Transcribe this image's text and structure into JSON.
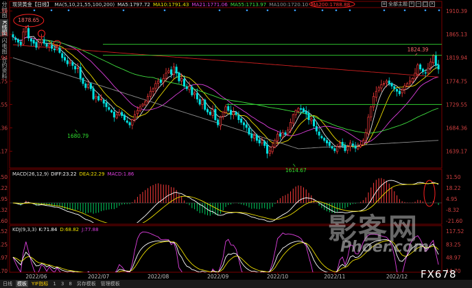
{
  "header": {
    "instrument": "现货黄金",
    "period_tag": "【日线】",
    "ma_items": [
      {
        "text": "MA(5,10,21,55,100,200)",
        "color": "#d0d0d0"
      },
      {
        "text": "MA5:1797.72",
        "color": "#e0e0e0"
      },
      {
        "text": "MA10:1791.43",
        "color": "#f0e000"
      },
      {
        "text": "MA21:1771.06",
        "color": "#e040e0"
      },
      {
        "text": "MA55:1713.97",
        "color": "#40e040"
      },
      {
        "text": "MA100:1720.10",
        "color": "#909090"
      },
      {
        "text": "MA200:1788.88",
        "color": "#ff3030"
      }
    ],
    "right_label": "全部主题"
  },
  "left_tabs": [
    {
      "label": "分时图",
      "active": false
    },
    {
      "label": "K线图",
      "active": true
    },
    {
      "label": "闪电图",
      "active": false
    },
    {
      "label": "合约资料",
      "active": false
    }
  ],
  "macd": {
    "title": "MACD(26,12,9)",
    "diff": "DIFF:23.22",
    "dea": "DEA:22.29",
    "macd": "MACD:1.86"
  },
  "kdj": {
    "title": "KDJ(9,3,3)",
    "k": "K:71.84",
    "d": "D:68.82",
    "j": "J:77.88"
  },
  "bottom_bar": [
    "日线",
    "模板",
    "YIF指标",
    "1",
    "3",
    "8",
    "另存模板",
    "管理模板"
  ],
  "left_bottom_tabs": [
    "指标"
  ],
  "watermark": {
    "line1": "影客网",
    "line2": "Phoer.com"
  },
  "fx_label": "FX678",
  "chart_data": [
    {
      "type": "candlestick",
      "title": "现货黄金【日线】",
      "y_ticks": [
        1910.39,
        1865.13,
        1819.94,
        1774.75,
        1729.55,
        1684.36,
        1639.17
      ],
      "ylim": [
        1614.67,
        1910.39
      ],
      "x_ticks": [
        "2022/06",
        "2022/07",
        "2022/08",
        "2022/09",
        "2022/10",
        "2022/11",
        "2022/12"
      ],
      "annotations": [
        {
          "label": "1878.65",
          "value": 1878.65
        },
        {
          "label": "1680.79",
          "value": 1680.79
        },
        {
          "label": "1614.67",
          "value": 1614.67
        },
        {
          "label": "1824.39",
          "value": 1824.39
        }
      ],
      "horizontal_lines": [
        1846,
        1825,
        1729.55
      ],
      "series": [
        {
          "name": "MA5",
          "last": 1797.72
        },
        {
          "name": "MA10",
          "last": 1791.43
        },
        {
          "name": "MA21",
          "last": 1771.06
        },
        {
          "name": "MA55",
          "last": 1713.97
        },
        {
          "name": "MA100",
          "last": 1720.1
        },
        {
          "name": "MA200",
          "last": 1788.88
        }
      ],
      "closes": [
        1860,
        1855,
        1850,
        1845,
        1870,
        1878,
        1858,
        1852,
        1848,
        1840,
        1850,
        1856,
        1848,
        1842,
        1845,
        1838,
        1835,
        1840,
        1830,
        1820,
        1815,
        1808,
        1812,
        1805,
        1798,
        1800,
        1780,
        1770,
        1762,
        1768,
        1760,
        1740,
        1745,
        1738,
        1740,
        1732,
        1725,
        1720,
        1715,
        1705,
        1710,
        1715,
        1708,
        1700,
        1695,
        1690,
        1700,
        1710,
        1718,
        1725,
        1730,
        1735,
        1745,
        1755,
        1760,
        1770,
        1775,
        1772,
        1780,
        1790,
        1795,
        1788,
        1802,
        1790,
        1775,
        1780,
        1765,
        1760,
        1765,
        1748,
        1752,
        1740,
        1730,
        1738,
        1720,
        1715,
        1710,
        1720,
        1700,
        1690,
        1705,
        1715,
        1725,
        1718,
        1710,
        1715,
        1710,
        1700,
        1695,
        1690,
        1685,
        1672,
        1665,
        1670,
        1660,
        1655,
        1660,
        1650,
        1635,
        1640,
        1648,
        1660,
        1672,
        1668,
        1675,
        1672,
        1680,
        1695,
        1710,
        1718,
        1722,
        1720,
        1715,
        1712,
        1700,
        1702,
        1688,
        1678,
        1670,
        1665,
        1660,
        1655,
        1650,
        1645,
        1640,
        1648,
        1655,
        1650,
        1640,
        1648,
        1655,
        1650,
        1645,
        1648,
        1652,
        1660,
        1675,
        1705,
        1725,
        1745,
        1755,
        1762,
        1768,
        1770,
        1775,
        1770,
        1765,
        1760,
        1755,
        1750,
        1758,
        1766,
        1770,
        1775,
        1780,
        1790,
        1806,
        1798,
        1793,
        1790,
        1800,
        1812,
        1824,
        1805,
        1798
      ]
    },
    {
      "type": "macd",
      "title": "MACD(26,12,9)",
      "y_ticks": [
        31.5,
        18.22,
        4.95,
        -8.32,
        -21.6
      ],
      "ylim": [
        -21.6,
        31.5
      ],
      "series": [
        {
          "name": "DIFF",
          "last": 23.22
        },
        {
          "name": "DEA",
          "last": 22.29
        },
        {
          "name": "MACD",
          "last": 1.86
        }
      ]
    },
    {
      "type": "kdj",
      "title": "KDJ(9,3,3)",
      "y_ticks": [
        117.52,
        83.25,
        48.97,
        14.7
      ],
      "ylim": [
        14.7,
        117.52
      ],
      "series": [
        {
          "name": "K",
          "last": 71.84
        },
        {
          "name": "D",
          "last": 68.82
        },
        {
          "name": "J",
          "last": 77.88
        }
      ]
    }
  ]
}
